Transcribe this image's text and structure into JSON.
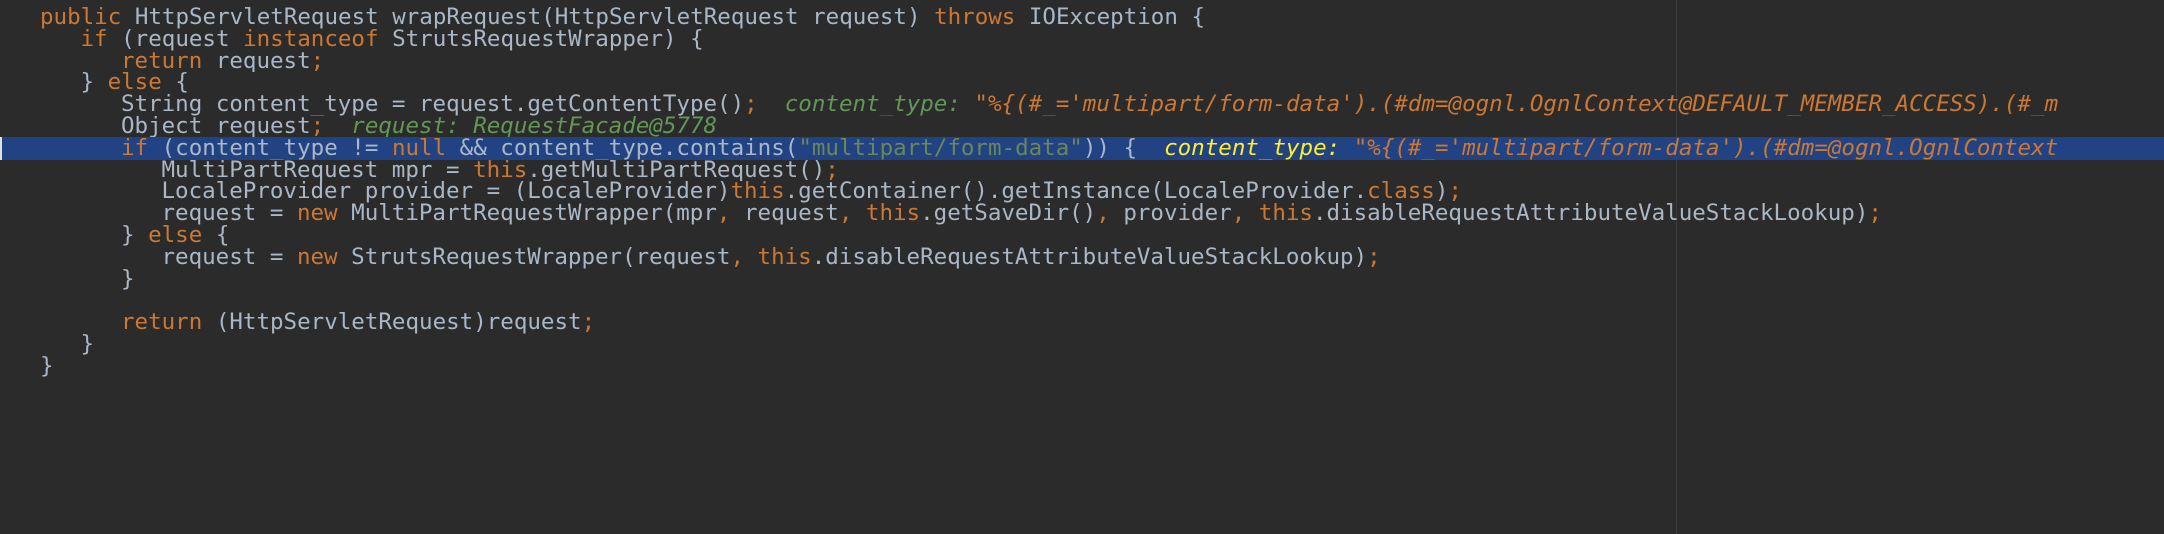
{
  "editor": {
    "lines": [
      {
        "indent": 1,
        "tokens": [
          {
            "t": "kw",
            "v": "public "
          },
          {
            "t": "pl",
            "v": "HttpServletRequest wrapRequest(HttpServletRequest request) "
          },
          {
            "t": "kw",
            "v": "throws "
          },
          {
            "t": "pl",
            "v": "IOException {"
          }
        ]
      },
      {
        "indent": 2,
        "tokens": [
          {
            "t": "kw",
            "v": "if "
          },
          {
            "t": "pl",
            "v": "(request "
          },
          {
            "t": "kw",
            "v": "instanceof "
          },
          {
            "t": "pl",
            "v": "StrutsRequestWrapper) {"
          }
        ]
      },
      {
        "indent": 3,
        "tokens": [
          {
            "t": "kw",
            "v": "return "
          },
          {
            "t": "pl",
            "v": "request"
          },
          {
            "t": "kw",
            "v": ";"
          }
        ]
      },
      {
        "indent": 2,
        "tokens": [
          {
            "t": "pl",
            "v": "} "
          },
          {
            "t": "kw",
            "v": "else "
          },
          {
            "t": "pl",
            "v": "{"
          }
        ]
      },
      {
        "indent": 3,
        "tokens": [
          {
            "t": "pl",
            "v": "String content_type = request.getContentType()"
          },
          {
            "t": "kw",
            "v": ";"
          },
          {
            "t": "pl",
            "v": "  "
          },
          {
            "t": "hint-label",
            "v": "content_type: "
          },
          {
            "t": "hint-value",
            "v": "\"%{(#_='multipart/form-data').(#dm=@ognl.OgnlContext@DEFAULT_MEMBER_ACCESS).(#_m"
          }
        ]
      },
      {
        "indent": 3,
        "tokens": [
          {
            "t": "pl",
            "v": "Object request"
          },
          {
            "t": "kw",
            "v": ";"
          },
          {
            "t": "pl",
            "v": "  "
          },
          {
            "t": "hint-label",
            "v": "request: RequestFacade@5778"
          }
        ]
      },
      {
        "indent": 3,
        "selected": true,
        "tokens": [
          {
            "t": "kw",
            "v": "if "
          },
          {
            "t": "pl",
            "v": "(content_type != "
          },
          {
            "t": "kw",
            "v": "null "
          },
          {
            "t": "pl",
            "v": "&& content_type.contains("
          },
          {
            "t": "str",
            "v": "\"multipart/form-data\""
          },
          {
            "t": "pl",
            "v": ")) {"
          },
          {
            "t": "pl",
            "v": "  "
          },
          {
            "t": "hint-sel-label",
            "v": "content_type: "
          },
          {
            "t": "hint-sel-value",
            "v": "\"%{(#_='multipart/form-data').(#dm=@ognl.OgnlContext"
          }
        ]
      },
      {
        "indent": 4,
        "tokens": [
          {
            "t": "pl",
            "v": "MultiPartRequest mpr = "
          },
          {
            "t": "kw",
            "v": "this"
          },
          {
            "t": "pl",
            "v": ".getMultiPartRequest()"
          },
          {
            "t": "kw",
            "v": ";"
          }
        ]
      },
      {
        "indent": 4,
        "tokens": [
          {
            "t": "pl",
            "v": "LocaleProvider provider = (LocaleProvider)"
          },
          {
            "t": "kw",
            "v": "this"
          },
          {
            "t": "pl",
            "v": ".getContainer().getInstance(LocaleProvider."
          },
          {
            "t": "kw",
            "v": "class"
          },
          {
            "t": "pl",
            "v": ")"
          },
          {
            "t": "kw",
            "v": ";"
          }
        ]
      },
      {
        "indent": 4,
        "tokens": [
          {
            "t": "pl",
            "v": "request = "
          },
          {
            "t": "kw",
            "v": "new "
          },
          {
            "t": "pl",
            "v": "MultiPartRequestWrapper(mpr"
          },
          {
            "t": "kw",
            "v": ", "
          },
          {
            "t": "pl",
            "v": "request"
          },
          {
            "t": "kw",
            "v": ", this"
          },
          {
            "t": "pl",
            "v": ".getSaveDir()"
          },
          {
            "t": "kw",
            "v": ", "
          },
          {
            "t": "pl",
            "v": "provider"
          },
          {
            "t": "kw",
            "v": ", this"
          },
          {
            "t": "pl",
            "v": ".disableRequestAttributeValueStackLookup)"
          },
          {
            "t": "kw",
            "v": ";"
          }
        ]
      },
      {
        "indent": 3,
        "tokens": [
          {
            "t": "pl",
            "v": "} "
          },
          {
            "t": "kw",
            "v": "else "
          },
          {
            "t": "pl",
            "v": "{"
          }
        ]
      },
      {
        "indent": 4,
        "tokens": [
          {
            "t": "pl",
            "v": "request = "
          },
          {
            "t": "kw",
            "v": "new "
          },
          {
            "t": "pl",
            "v": "StrutsRequestWrapper(request"
          },
          {
            "t": "kw",
            "v": ", this"
          },
          {
            "t": "pl",
            "v": ".disableRequestAttributeValueStackLookup)"
          },
          {
            "t": "kw",
            "v": ";"
          }
        ]
      },
      {
        "indent": 3,
        "tokens": [
          {
            "t": "pl",
            "v": "}"
          }
        ]
      },
      {
        "indent": 0,
        "tokens": []
      },
      {
        "indent": 3,
        "tokens": [
          {
            "t": "kw",
            "v": "return "
          },
          {
            "t": "pl",
            "v": "(HttpServletRequest)request"
          },
          {
            "t": "kw",
            "v": ";"
          }
        ]
      },
      {
        "indent": 2,
        "tokens": [
          {
            "t": "pl",
            "v": "}"
          }
        ]
      },
      {
        "indent": 1,
        "tokens": [
          {
            "t": "pl",
            "v": "}"
          }
        ]
      }
    ]
  }
}
